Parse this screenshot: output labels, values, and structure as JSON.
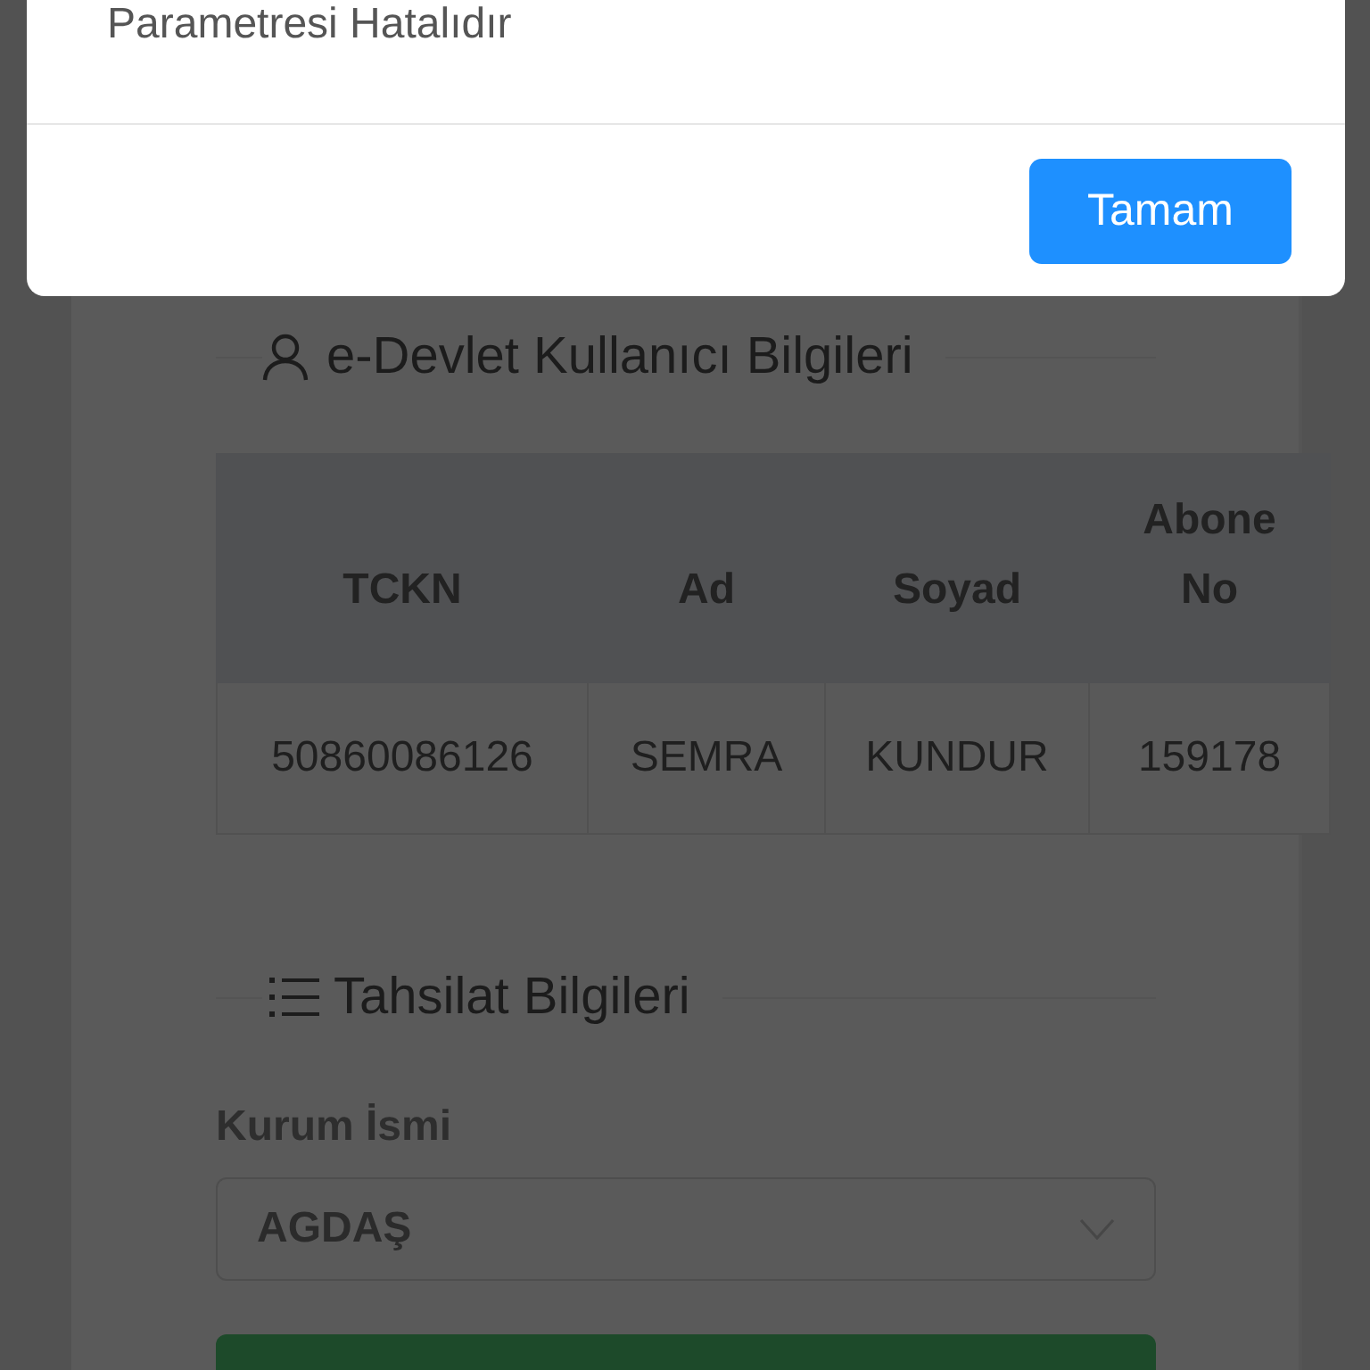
{
  "dialog": {
    "message": "Parametresi Hatalıdır",
    "buttons": [
      {
        "label": "Tamam"
      }
    ]
  },
  "user_section": {
    "title": "e-Devlet Kullanıcı Bilgileri",
    "table": {
      "columns": [
        "TCKN",
        "Ad",
        "Soyad",
        "Abone No"
      ],
      "rows": [
        [
          "50860086126",
          "SEMRA",
          "KUNDUR",
          "159178"
        ]
      ]
    }
  },
  "collection_section": {
    "title": "Tahsilat Bilgileri",
    "fields": [
      {
        "label": "Kurum İsmi",
        "value": "AGDAŞ"
      }
    ]
  }
}
